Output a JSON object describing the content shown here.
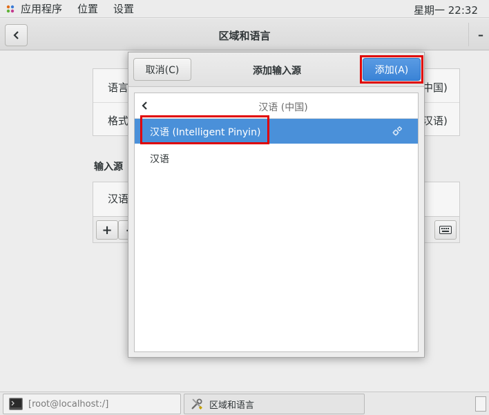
{
  "topbar": {
    "applications": "应用程序",
    "places": "位置",
    "settings": "设置",
    "clock": "星期一 22:32"
  },
  "window": {
    "title": "区域和语言",
    "minimize": "–"
  },
  "background": {
    "language_label": "语言",
    "formats_label": "格式",
    "language_value_fragment": "中国)",
    "formats_value_fragment": "汉语)",
    "input_sources_heading": "输入源",
    "input_source_item": "汉语",
    "add_symbol": "+",
    "remove_symbol": "–"
  },
  "dialog": {
    "title": "添加输入源",
    "cancel_label": "取消(C)",
    "add_label": "添加(A)",
    "list_header": "汉语 (中国)",
    "items": [
      {
        "label": "汉语 (Intelligent Pinyin)",
        "selected": true,
        "has_settings": true
      },
      {
        "label": "汉语",
        "selected": false,
        "has_settings": false
      }
    ]
  },
  "taskbar": {
    "terminal_label": "[root@localhost:/]",
    "settings_label": "区域和语言"
  },
  "colors": {
    "accent": "#4a90d9",
    "highlight_outline": "#e00000"
  }
}
